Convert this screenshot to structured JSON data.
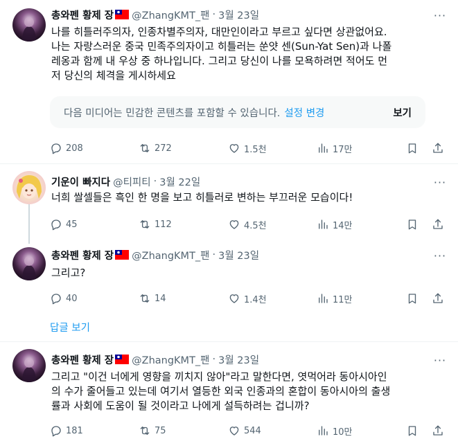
{
  "colors": {
    "accent": "#1d9bf0",
    "secondary_text": "#536471",
    "primary_text": "#0f1419",
    "divider": "#eff3f4"
  },
  "tweets": [
    {
      "name": "총와펜 황제 장",
      "flag": "taiwan-flag",
      "handle": "@ZhangKMT_팬",
      "sep": "·",
      "date": "3월 23일",
      "text": "나를 히틀러주의자, 인종차별주의자, 대만인이라고 부르고 싶다면 상관없어요.\n나는 자랑스러운 중국 민족주의자이고 히틀러는 쑨얏 센(Sun-Yat Sen)과 나폴\n레옹과 함께 내 우상 중 하나입니다. 그리고 당신이 나를 모욕하려면 적어도 먼\n저 당신의 체격을 게시하세요",
      "sensitive": {
        "message": "다음 미디어는 민감한 콘텐츠를 포함할 수 있습니다.",
        "settings_label": "설정 변경",
        "view_label": "보기"
      },
      "replies": "208",
      "retweets": "272",
      "likes": "1.5천",
      "views": "17만"
    },
    {
      "name": "기운이 빠지다",
      "handle": "@티피티",
      "sep": "·",
      "date": "3월 22일",
      "text": "너희 쌀셀들은 흑인 한 명을 보고 히틀러로 변하는 부끄러운 모습이다!",
      "replies": "45",
      "retweets": "112",
      "likes": "4.5천",
      "views": "14만"
    },
    {
      "name": "총와펜 황제 장",
      "flag": "taiwan-flag",
      "handle": "@ZhangKMT_팬",
      "sep": "·",
      "date": "3월 23일",
      "text": "그리고?",
      "replies": "40",
      "retweets": "14",
      "likes": "1.4천",
      "views": "11만",
      "show_replies": "답글 보기"
    },
    {
      "name": "총와펜 황제 장",
      "flag": "taiwan-flag",
      "handle": "@ZhangKMT_팬",
      "sep": "·",
      "date": "3월 23일",
      "text": "그리고 \"이건 너에게 영향을 끼치지 않아\"라고 말한다면, 엿먹어라 동아시아인\n의 수가 줄어들고 있는데 여기서 열등한 외국 인종과의 혼합이 동아시아의 출생\n률과 사회에 도움이 될 것이라고 나에게 설득하려는 겁니까?",
      "replies": "181",
      "retweets": "75",
      "likes": "544",
      "views": "10만"
    }
  ],
  "icons": {
    "more": "more-dots-icon",
    "reply": "reply-bubble-icon",
    "retweet": "retweet-icon",
    "like": "heart-icon",
    "views": "views-bars-icon",
    "bookmark": "bookmark-icon",
    "share": "share-icon"
  }
}
